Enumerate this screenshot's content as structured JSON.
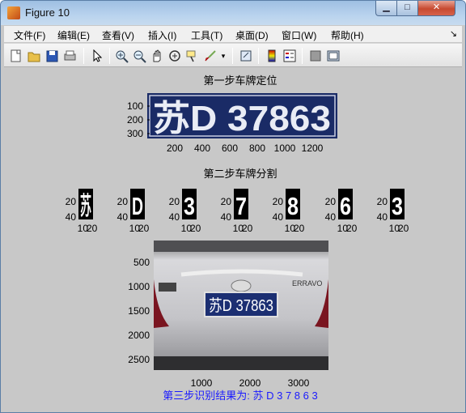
{
  "window": {
    "title": "Figure 10"
  },
  "menu": [
    "文件(F)",
    "编辑(E)",
    "查看(V)",
    "插入(I)",
    "工具(T)",
    "桌面(D)",
    "窗口(W)",
    "帮助(H)"
  ],
  "toolbar_icons": [
    "new-figure-icon",
    "open-file-icon",
    "save-icon",
    "print-icon",
    "pointer-icon",
    "zoom-in-icon",
    "zoom-out-icon",
    "pan-icon",
    "rotate-icon",
    "data-cursor-icon",
    "brush-icon",
    "link-plot-icon",
    "colorbar-icon",
    "legend-icon",
    "hide-plot-tools-icon",
    "show-plot-tools-icon"
  ],
  "step1": {
    "title": "第一步车牌定位",
    "plate_text": "苏D 37863",
    "xticks": [
      "200",
      "400",
      "600",
      "800",
      "1000",
      "1200"
    ],
    "yticks": [
      "100",
      "200",
      "300"
    ]
  },
  "step2": {
    "title": "第二步车牌分割",
    "chars": [
      "苏",
      "D",
      "3",
      "7",
      "8",
      "6",
      "3"
    ],
    "yticks": [
      "20",
      "40"
    ],
    "xticks": [
      "10",
      "20"
    ]
  },
  "step3": {
    "xticks": [
      "1000",
      "2000",
      "3000"
    ],
    "yticks": [
      "500",
      "1000",
      "1500",
      "2000",
      "2500"
    ],
    "photo_plate": "苏D 37863",
    "car_badge": "ERRAVO",
    "result": "第三步识别结果为: 苏 D 3 7 8 6 3"
  },
  "colors": {
    "figure_bg": "#c8c8c8",
    "plate_blue": "#1a2b66",
    "result_blue": "#1a1aff"
  }
}
